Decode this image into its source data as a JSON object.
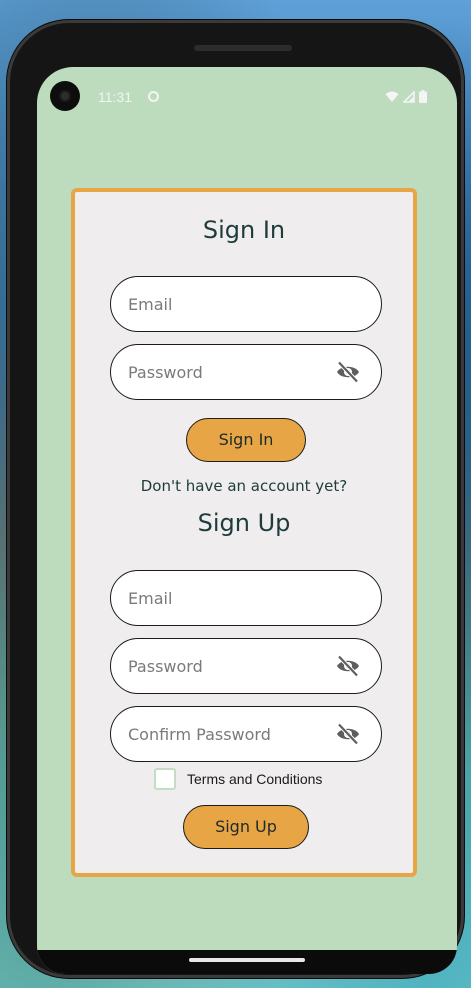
{
  "status_bar": {
    "time": "11:31",
    "app_icon": "circle-status-icon",
    "icons": [
      "wifi-icon",
      "signal-icon",
      "battery-icon"
    ]
  },
  "sign_in": {
    "title": "Sign In",
    "email_placeholder": "Email",
    "password_placeholder": "Password",
    "button_label": "Sign In"
  },
  "prompt_text": "Don't have an account yet?",
  "sign_up": {
    "title": "Sign Up",
    "email_placeholder": "Email",
    "password_placeholder": "Password",
    "confirm_password_placeholder": "Confirm Password",
    "terms_label": "Terms and Conditions",
    "terms_checked": false,
    "button_label": "Sign Up"
  },
  "colors": {
    "screen_background": "#bddbbd",
    "card_background": "#efeded",
    "card_border": "#e8a545",
    "button_fill": "#e8a545",
    "heading_text": "#1e3c3c"
  }
}
